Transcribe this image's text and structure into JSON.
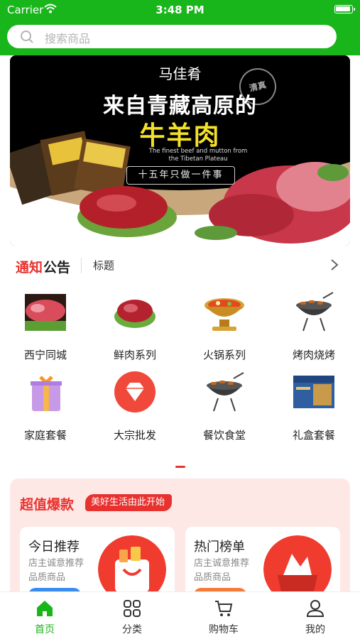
{
  "status_bar": {
    "carrier": "Carrier",
    "time": "3:48 PM"
  },
  "search": {
    "placeholder": "搜索商品"
  },
  "banner": {
    "brand": "马佳肴",
    "seal": "清真",
    "headline": "来自青藏高原的",
    "product": "牛羊肉",
    "english_line1": "The finest beef and mutton from",
    "english_line2": "the Tibetan Plateau",
    "slogan": "十五年只做一件事"
  },
  "notice": {
    "label_red": "通知",
    "label_dark": "公告",
    "title": "标题"
  },
  "categories": [
    {
      "label": "西宁同城",
      "icon": "raw-beef-image"
    },
    {
      "label": "鲜肉系列",
      "icon": "fresh-meat-image"
    },
    {
      "label": "火锅系列",
      "icon": "hotpot-image"
    },
    {
      "label": "烤肉烧烤",
      "icon": "bbq-grill-image"
    },
    {
      "label": "家庭套餐",
      "icon": "gift-box-image"
    },
    {
      "label": "大宗批发",
      "icon": "diamond-badge-image"
    },
    {
      "label": "餐饮食堂",
      "icon": "bbq-grill-image"
    },
    {
      "label": "礼盒套餐",
      "icon": "gift-package-image"
    }
  ],
  "deals": {
    "title": "超值爆款",
    "tag": "美好生活由此开始",
    "cards": [
      {
        "title": "今日推荐",
        "sub1": "店主诚意推荐",
        "sub2": "品质商品"
      },
      {
        "title": "热门榜单",
        "sub1": "店主诚意推荐",
        "sub2": "品质商品"
      }
    ]
  },
  "tabs": [
    {
      "label": "首页",
      "icon": "home-icon",
      "active": true
    },
    {
      "label": "分类",
      "icon": "grid-icon"
    },
    {
      "label": "购物车",
      "icon": "cart-icon"
    },
    {
      "label": "我的",
      "icon": "profile-icon"
    }
  ],
  "colors": {
    "brand_green": "#19b61b",
    "accent_red": "#e8322f"
  }
}
